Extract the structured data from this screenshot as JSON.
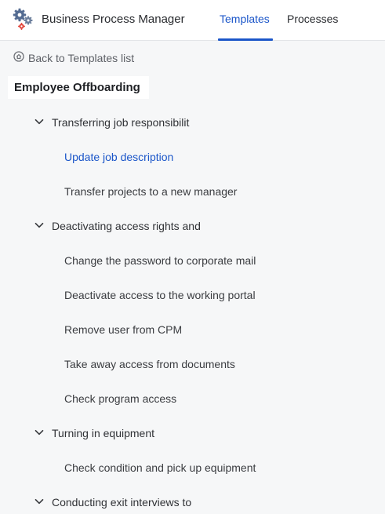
{
  "header": {
    "app_title": "Business Process Manager",
    "logo_icon": "gears-icon",
    "tabs": [
      {
        "label": "Templates",
        "active": true
      },
      {
        "label": "Processes",
        "active": false
      }
    ]
  },
  "back_link": {
    "icon": "home-icon",
    "label": "Back to Templates list"
  },
  "template": {
    "title": "Employee Offboarding"
  },
  "tree": {
    "groups": [
      {
        "label": "Transferring job responsibilit",
        "expanded": true,
        "items": [
          {
            "label": "Update job description",
            "active": true
          },
          {
            "label": "Transfer projects to a new manager",
            "active": false
          }
        ]
      },
      {
        "label": "Deactivating access rights and",
        "expanded": true,
        "items": [
          {
            "label": "Change the password to corporate mail",
            "active": false
          },
          {
            "label": "Deactivate access to the working portal",
            "active": false
          },
          {
            "label": "Remove user from CPM",
            "active": false
          },
          {
            "label": "Take away access from documents",
            "active": false
          },
          {
            "label": "Check program access",
            "active": false
          }
        ]
      },
      {
        "label": "Turning in equipment",
        "expanded": true,
        "items": [
          {
            "label": "Check condition and pick up equipment",
            "active": false
          }
        ]
      },
      {
        "label": "Conducting exit interviews to",
        "expanded": true,
        "items": []
      }
    ]
  },
  "colors": {
    "accent": "#1b56c9",
    "background": "#f6f7f8",
    "header_bg": "#ffffff",
    "text": "#303236"
  }
}
